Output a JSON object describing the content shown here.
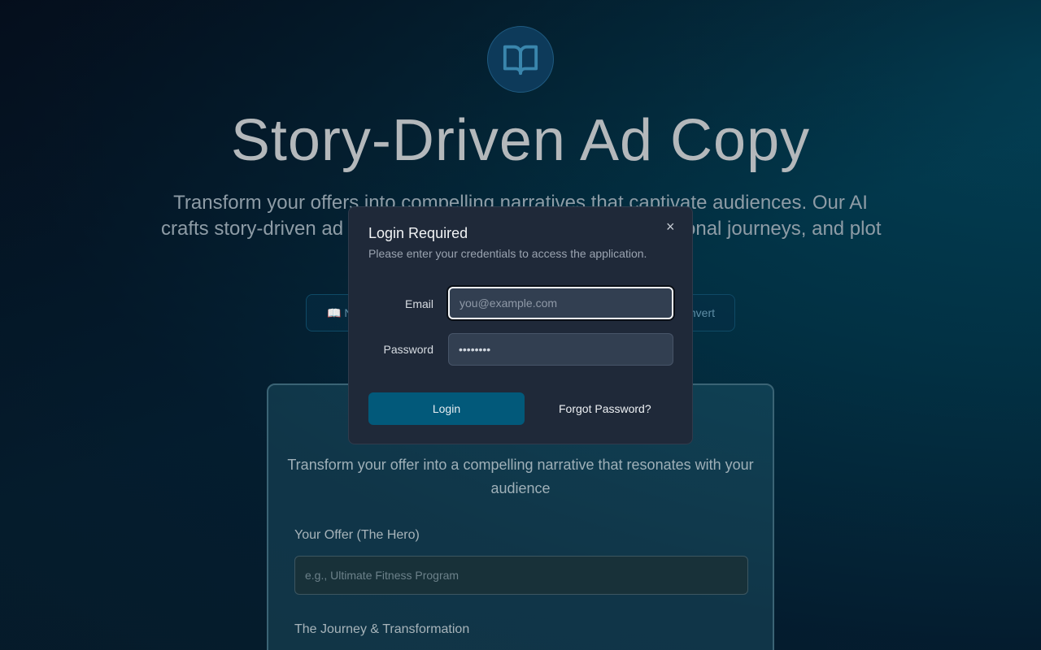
{
  "hero": {
    "icon": "book-open-icon",
    "title": "Story-Driven Ad Copy",
    "subtitle_line1": "Transform your offers into compelling narratives that captivate audiences. Our AI",
    "subtitle_line2_left": "crafts story-driven ad c",
    "subtitle_line2_right": "onal journeys, and plot"
  },
  "tabs": {
    "left_label": "📖 N",
    "right_label": "nvert"
  },
  "form": {
    "description": "Transform your offer into a compelling narrative that resonates with your audience",
    "offer_label": "Your Offer (The Hero)",
    "offer_placeholder": "e.g., Ultimate Fitness Program",
    "journey_label": "The Journey & Transformation"
  },
  "modal": {
    "title": "Login Required",
    "subtitle": "Please enter your credentials to access the application.",
    "close": "×",
    "email_label": "Email",
    "email_placeholder": "you@example.com",
    "password_label": "Password",
    "password_value": "••••••••",
    "login_label": "Login",
    "forgot_label": "Forgot Password?"
  }
}
